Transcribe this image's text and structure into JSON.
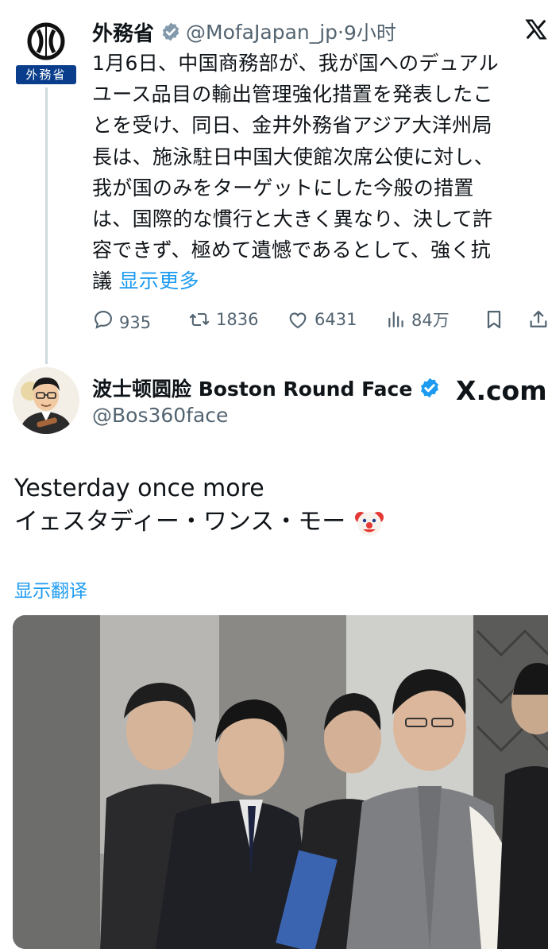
{
  "tweet1": {
    "avatar_label": "外務省",
    "display_name": "外務省",
    "handle": "@MofaJapan_jp",
    "separator": "·",
    "time": "9小时",
    "body_lines": [
      "1月6日、中国商務部が、我が国へのデュアル",
      "ユース品目の輸出管理強化措置を発表したこ",
      "とを受け、同日、金井外務省アジア大洋州局",
      "長は、施泳駐日中国大使館次席公使に対し、",
      "我が国のみをターゲットにした今般の措置",
      "は、国際的な慣行と大きく異なり、決して許",
      "容できず、極めて遺憾であるとして、強く抗"
    ],
    "last_line": "議",
    "show_more": "显示更多",
    "replies": "935",
    "reposts": "1836",
    "likes": "6431",
    "views": "84万"
  },
  "tweet2": {
    "display_name": "波士顿圆脸 Boston Round Face",
    "handle": "@Bos360face",
    "watermark": "X.com",
    "text_line1": "Yesterday once more",
    "text_line2": "イェスタディー・ワンス・モー",
    "emoji_icon": "clown-face-icon",
    "translate_label": "显示翻译"
  },
  "colors": {
    "link_blue": "#1d9bf0",
    "verified_gray": "#829aab",
    "verified_blue": "#1d9bf0",
    "secondary_text": "#536471",
    "mofa_navy": "#0a3e8c"
  }
}
